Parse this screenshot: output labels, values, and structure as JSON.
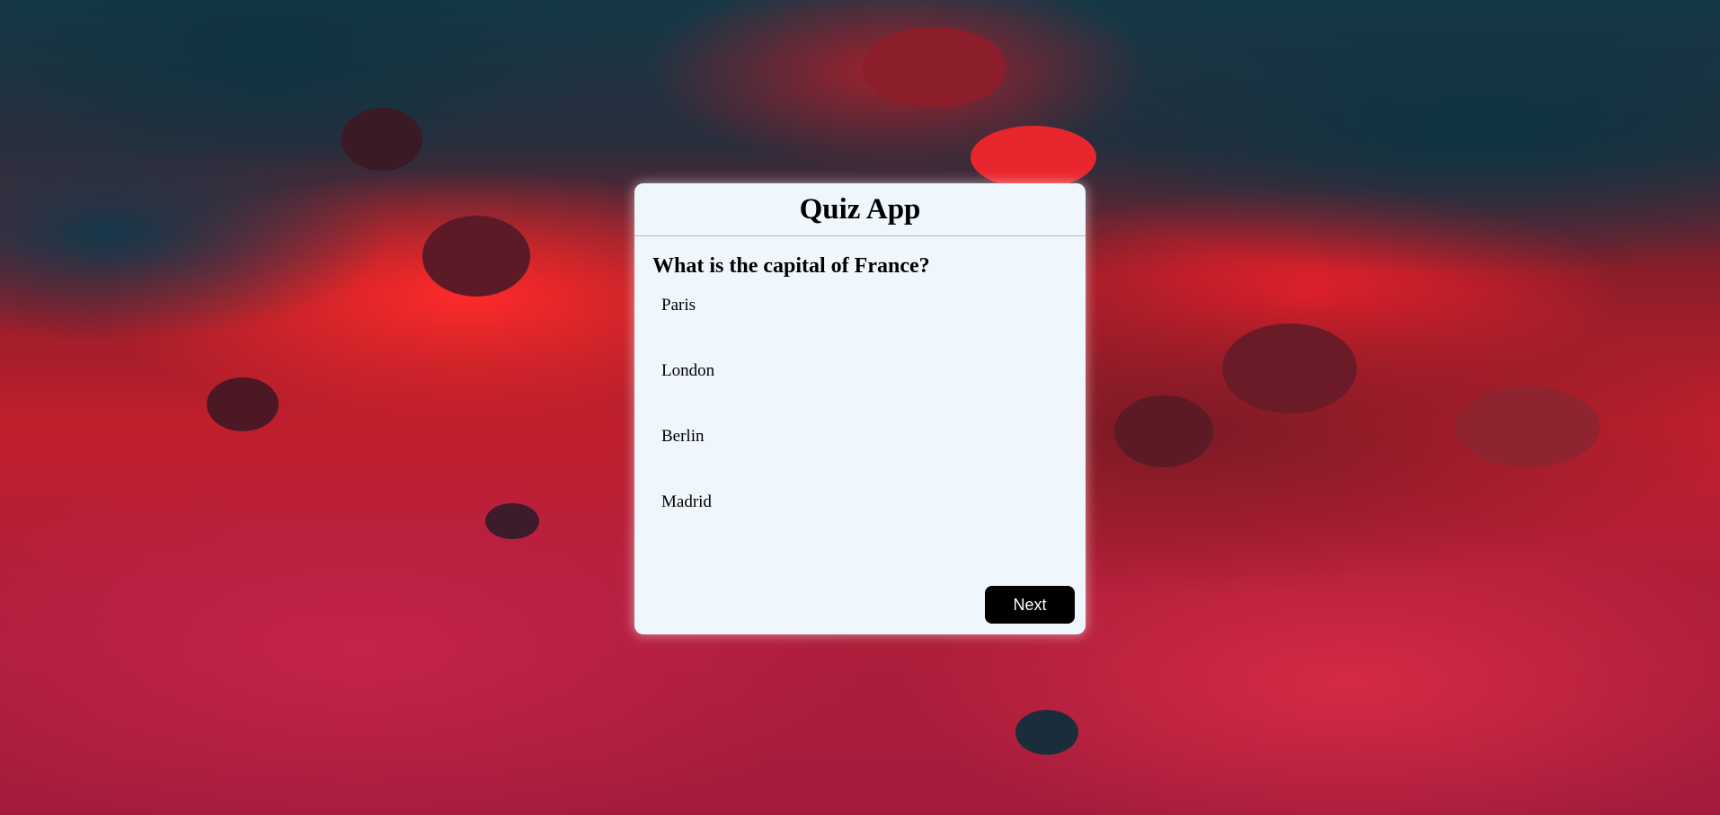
{
  "app": {
    "title": "Quiz App"
  },
  "quiz": {
    "question": "What is the capital of France?",
    "options": [
      "Paris",
      "London",
      "Berlin",
      "Madrid"
    ],
    "next_label": "Next"
  },
  "theme": {
    "card_background": "#eff6fc",
    "button_background": "#000000",
    "button_text": "#ffffff"
  }
}
